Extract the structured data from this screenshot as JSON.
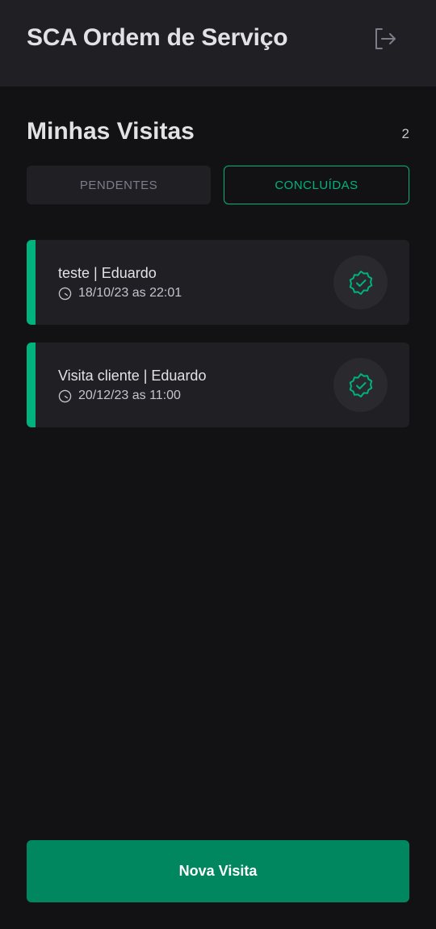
{
  "header": {
    "title": "SCA Ordem de Serviço",
    "logout_icon": "sign-out-icon"
  },
  "section": {
    "title": "Minhas Visitas",
    "count": "2"
  },
  "tabs": [
    {
      "label": "PENDENTES",
      "active": false
    },
    {
      "label": "CONCLUÍDAS",
      "active": true
    }
  ],
  "visits": [
    {
      "title": "teste | Eduardo",
      "datetime": "18/10/23 as 22:01",
      "status_icon": "seal-check-icon"
    },
    {
      "title": "Visita cliente | Eduardo",
      "datetime": "20/12/23 as 11:00",
      "status_icon": "seal-check-icon"
    }
  ],
  "footer": {
    "new_visit_label": "Nova Visita"
  },
  "colors": {
    "background": "#121214",
    "surface": "#202024",
    "accent": "#00b37e",
    "button": "#00875f"
  }
}
